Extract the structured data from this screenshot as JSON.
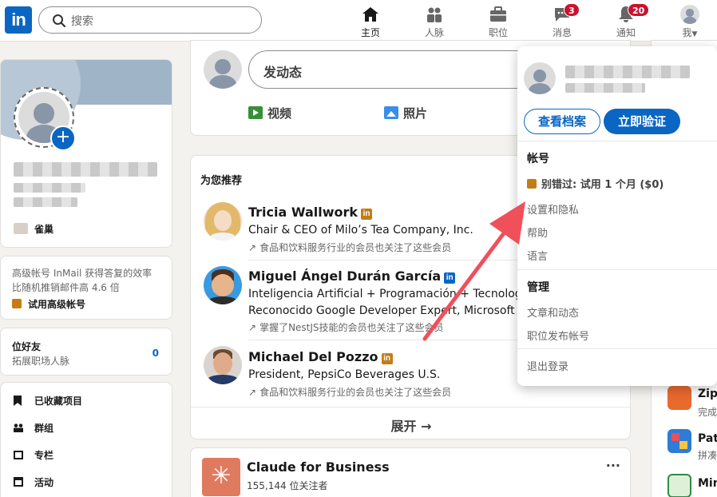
{
  "nav": {
    "logo": "in",
    "search_placeholder": "搜索",
    "items": [
      {
        "label": "主页",
        "icon": "home-icon",
        "active": true
      },
      {
        "label": "人脉",
        "icon": "network-icon"
      },
      {
        "label": "职位",
        "icon": "briefcase-icon"
      },
      {
        "label": "消息",
        "icon": "messaging-icon",
        "badge": "3"
      },
      {
        "label": "通知",
        "icon": "bell-icon",
        "badge": "20"
      },
      {
        "label": "我",
        "icon": "avatar"
      }
    ]
  },
  "left": {
    "org": "雀巢",
    "premium_promo": "高级帐号 InMail 获得答复的效率比随机推销邮件高 4.6 倍",
    "premium_cta": "试用高级帐号",
    "connections_title": "位好友",
    "connections_sub": "拓展职场人脉",
    "connections_count": "0",
    "menu": [
      {
        "label": "已收藏项目",
        "icon": "bookmark-icon"
      },
      {
        "label": "群组",
        "icon": "groups-icon"
      },
      {
        "label": "专栏",
        "icon": "newsletter-icon"
      },
      {
        "label": "活动",
        "icon": "calendar-icon"
      }
    ]
  },
  "composer": {
    "placeholder": "发动态",
    "video": "视频",
    "photo": "照片"
  },
  "recommend": {
    "title": "为您推荐",
    "people": [
      {
        "name": "Tricia Wallwork",
        "title": "Chair & CEO of Milo’s Tea Company, Inc.",
        "note": "食品和饮料服务行业的会员也关注了这些会员",
        "badge_color": "#c37d16"
      },
      {
        "name": "Miguel Ángel Durán García",
        "title": "Inteligencia Artificial + Programación + Tecnología",
        "title2": "Reconocido Google Developer Expert, Microsoft M",
        "note": "掌握了NestJS技能的会员也关注了这些会员",
        "badge_color": "#0a66c2"
      },
      {
        "name": "Michael Del Pozzo",
        "title": "President, PepsiCo Beverages U.S.",
        "note": "食品和饮料服务行业的会员也关注了这些会员",
        "badge_color": "#c37d16"
      }
    ],
    "expand": "展开 →"
  },
  "company": {
    "name": "Claude for Business",
    "followers": "155,144 位关注者",
    "more": "···"
  },
  "right": {
    "items": [
      "Zip",
      "完成",
      "Pat",
      "拼凑",
      "Min"
    ]
  },
  "dropdown": {
    "view_profile": "查看档案",
    "verify": "立即验证",
    "account_title": "帐号",
    "premium_trial": "别错过: 试用 1 个月 ($0)",
    "links_account": [
      "设置和隐私",
      "帮助",
      "语言"
    ],
    "manage_title": "管理",
    "links_manage": [
      "文章和动态",
      "职位发布帐号"
    ],
    "sign_out": "退出登录"
  },
  "colors": {
    "brand": "#0a66c2",
    "annotation_arrow": "#f0505a"
  }
}
